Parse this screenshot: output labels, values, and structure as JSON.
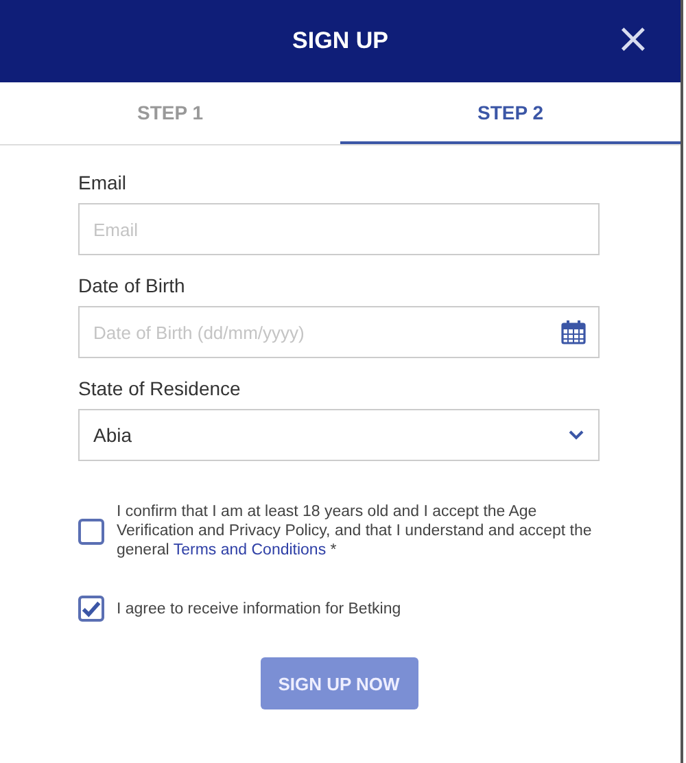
{
  "header": {
    "title": "SIGN UP",
    "close": "×"
  },
  "tabs": [
    {
      "label": "STEP 1",
      "selected": false
    },
    {
      "label": "STEP 2",
      "selected": true
    }
  ],
  "fields": [
    {
      "kind": "text",
      "label": "Email",
      "placeholder": "Email"
    },
    {
      "kind": "date",
      "label": "Date of Birth",
      "placeholder": "Date of Birth (dd/mm/yyyy)"
    },
    {
      "kind": "select",
      "label": "State of Residence",
      "value": "Abia"
    }
  ],
  "checks": [
    {
      "checked": false,
      "text": "I confirm that I am at least 18 years old and I accept the Age Verification and Privacy Policy, and that I understand and accept the general ",
      "link": "Terms and Conditions",
      "after": " *"
    },
    {
      "checked": true,
      "text": "I agree to receive information for Betking"
    }
  ],
  "submit": {
    "label": "SIGN UP NOW",
    "disabled": true
  }
}
